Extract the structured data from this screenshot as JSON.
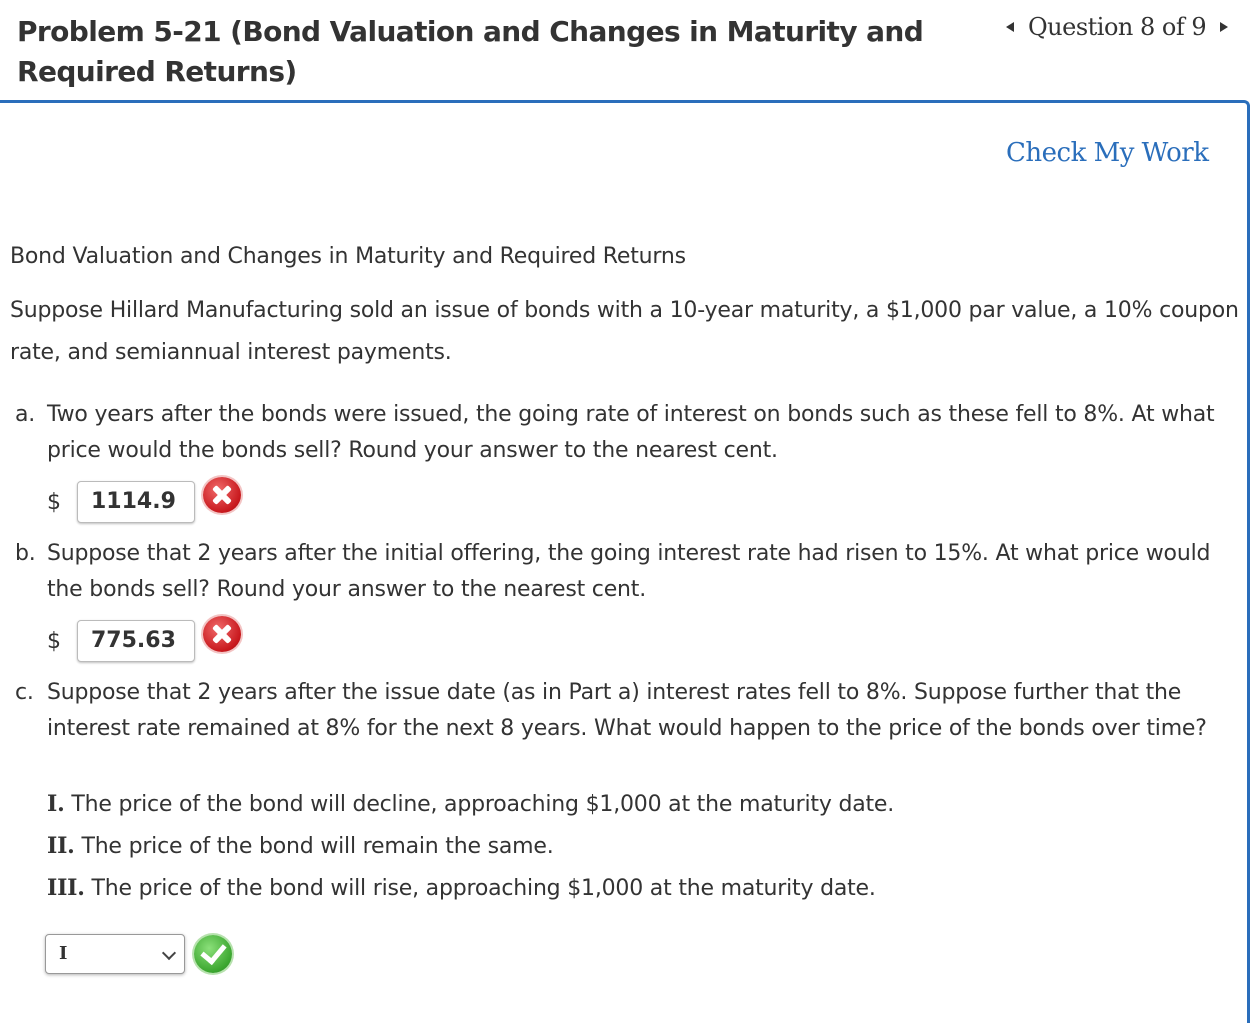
{
  "header": {
    "title": "Problem 5-21 (Bond Valuation and Changes in Maturity and Required Returns)",
    "question_nav": "Question 8 of 9"
  },
  "check_my_work": "Check My Work",
  "section_title": "Bond Valuation and Changes in Maturity and Required Returns",
  "intro": "Suppose Hillard Manufacturing sold an issue of bonds with a 10-year maturity, a $1,000 par value, a 10% coupon rate, and semiannual interest payments.",
  "questions": {
    "a": {
      "label": "a.",
      "text": "Two years after the bonds were issued, the going rate of interest on bonds such as these fell to 8%. At what price would the bonds sell? Round your answer to the nearest cent.",
      "currency": "$",
      "answer": "1114.9",
      "status": "incorrect"
    },
    "b": {
      "label": "b.",
      "text": "Suppose that 2 years after the initial offering, the going interest rate had risen to 15%. At what price would the bonds sell? Round your answer to the nearest cent.",
      "currency": "$",
      "answer": "775.63",
      "status": "incorrect"
    },
    "c": {
      "label": "c.",
      "text": "Suppose that 2 years after the issue date (as in Part a) interest rates fell to 8%. Suppose further that the interest rate remained at 8% for the next 8 years. What would happen to the price of the bonds over time?",
      "options": [
        {
          "roman": "I.",
          "text": "The price of the bond will decline, approaching $1,000 at the maturity date."
        },
        {
          "roman": "II.",
          "text": "The price of the bond will remain the same."
        },
        {
          "roman": "III.",
          "text": "The price of the bond will rise, approaching $1,000 at the maturity date."
        }
      ],
      "selected": "I",
      "status": "correct"
    }
  },
  "colors": {
    "accent_blue": "#2a6ebb",
    "incorrect_red": "#c8181d",
    "correct_green": "#3ba62f"
  },
  "icons": {
    "incorrect": "x-circle-icon",
    "correct": "check-circle-icon",
    "prev": "triangle-left-icon",
    "next": "triangle-right-icon",
    "dropdown": "chevron-down-icon"
  }
}
